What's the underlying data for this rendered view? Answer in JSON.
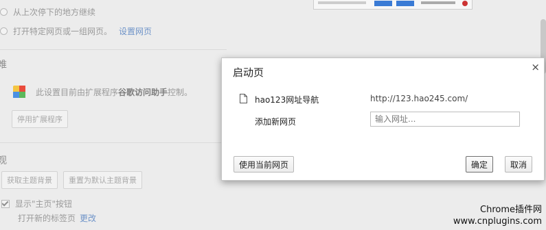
{
  "background": {
    "option_continue": "从上次停下的地方继续",
    "option_specific": "打开特定网页或一组网页。",
    "set_pages_link": "设置网页",
    "section_glyph_1": "难",
    "extension_notice_prefix": "此设置目前由扩展程序",
    "extension_name": "谷歌访问助手",
    "extension_notice_suffix": "控制。",
    "disable_extension_button": "停用扩展程序",
    "section_glyph_2": "观",
    "get_theme_button": "获取主题背景",
    "reset_theme_button": "重置为默认主题背景",
    "show_home_label": "显示\"主页\"按钮",
    "new_tab_text": "打开新的标签页",
    "change_link": "更改"
  },
  "dialog": {
    "title": "启动页",
    "close_glyph": "×",
    "pages": [
      {
        "name": "hao123网址导航",
        "url": "http://123.hao245.com/"
      }
    ],
    "add_label": "添加新网页",
    "input_placeholder": "输入网址...",
    "use_current_button": "使用当前网页",
    "ok_button": "确定",
    "cancel_button": "取消"
  },
  "watermark": {
    "line1": "Chrome插件网",
    "line2": "www.cnplugins.com"
  },
  "colors": {
    "link": "#6e93c8",
    "dialog_bg": "#ffffff",
    "overlay_bg": "#ececec"
  }
}
